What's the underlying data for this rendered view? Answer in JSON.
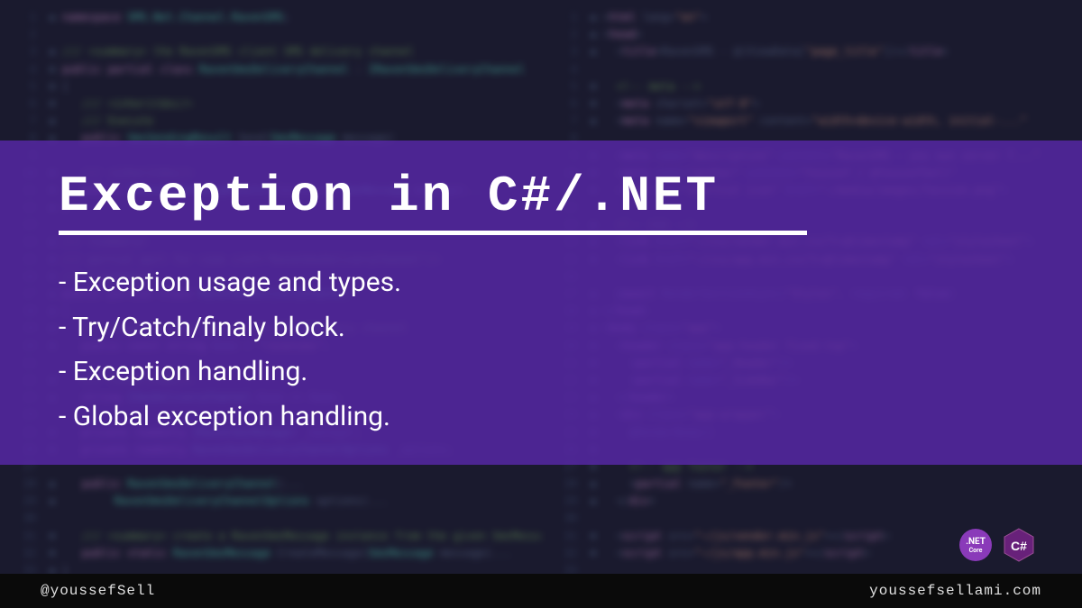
{
  "title": "Exception in C#/.NET",
  "bullets": [
    "- Exception usage and types.",
    "- Try/Catch/finaly block.",
    "- Exception handling.",
    "- Global exception handling."
  ],
  "footer": {
    "handle": "@youssefSell",
    "site": "youssefsellami.com"
  },
  "badges": {
    "net_label": ".NET",
    "net_sub": "Core",
    "csharp_label": "C#"
  }
}
